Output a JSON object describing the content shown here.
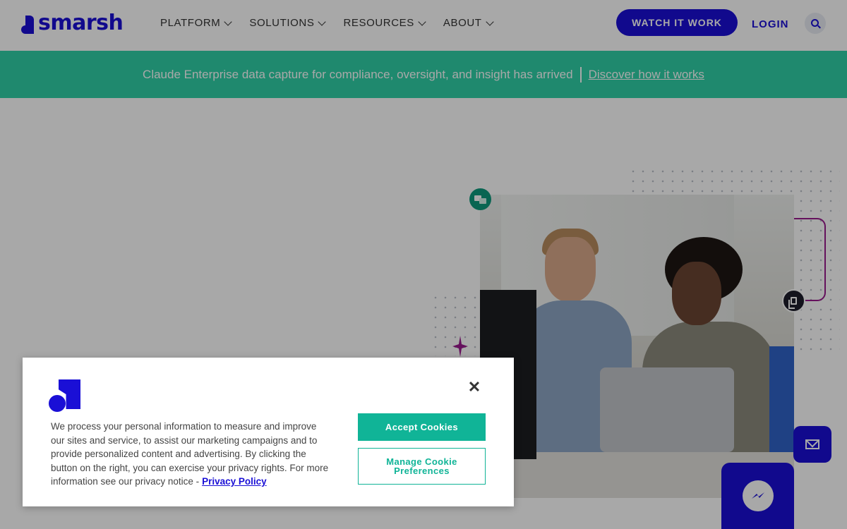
{
  "header": {
    "brand": "smarsh",
    "nav": [
      {
        "label": "PLATFORM"
      },
      {
        "label": "SOLUTIONS"
      },
      {
        "label": "RESOURCES"
      },
      {
        "label": "ABOUT"
      }
    ],
    "watch_label": "WATCH IT WORK",
    "login_label": "LOGIN"
  },
  "banner": {
    "text": "Claude Enterprise data capture for compliance, oversight, and insight has arrived",
    "link": "Discover how it works"
  },
  "cookie": {
    "body": "We process your personal information to measure and improve our sites and service, to assist our marketing campaigns and to provide personalized content and advertising. By clicking the button on the right, you can exercise your privacy rights. For more information see our privacy notice -",
    "privacy_link": "Privacy Policy",
    "accept_label": "Accept Cookies",
    "manage_label": "Manage Cookie Preferences",
    "close_glyph": "✕"
  },
  "colors": {
    "brand": "#1a0fd6",
    "banner": "#2fd0a8",
    "accent": "#10b497",
    "magenta": "#9a1b8e"
  },
  "icons": [
    "search-icon",
    "chevron-down-icon",
    "chat-icon",
    "copy-icon",
    "sparkle-icon",
    "mail-icon",
    "messenger-icon",
    "close-icon"
  ]
}
